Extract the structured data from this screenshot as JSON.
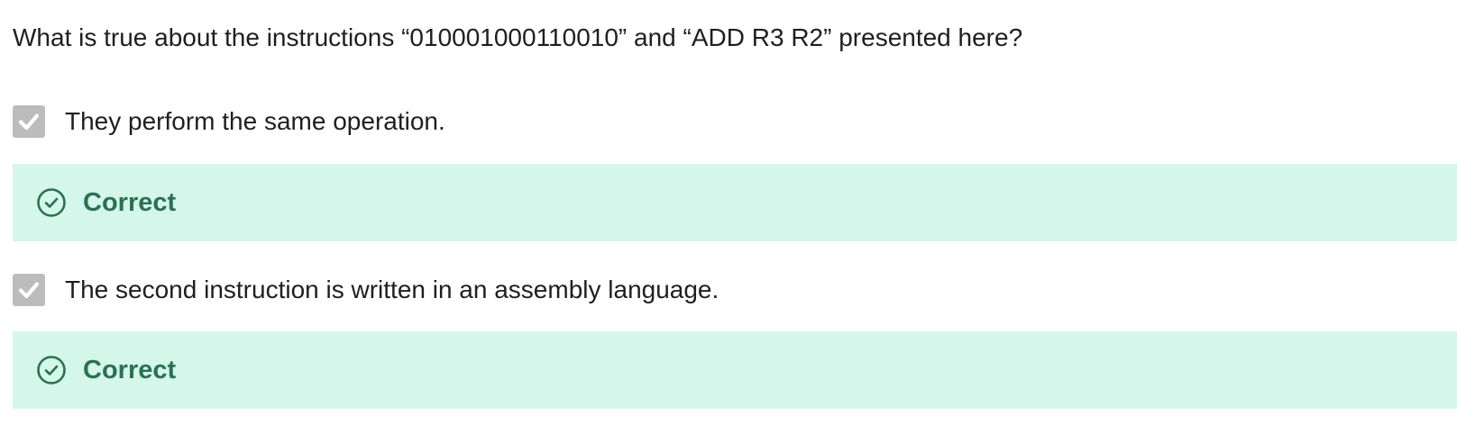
{
  "question": {
    "text": "What is true about the instructions “010001000110010” and “ADD R3 R2” presented here?"
  },
  "options": [
    {
      "label": "They perform the same operation.",
      "checked": true,
      "checkbox_icon": "checkmark-icon",
      "feedback": {
        "label": "Correct",
        "icon": "check-circle-icon"
      }
    },
    {
      "label": "The second instruction is written in an assembly language.",
      "checked": true,
      "checkbox_icon": "checkmark-icon",
      "feedback": {
        "label": "Correct",
        "icon": "check-circle-icon"
      }
    }
  ],
  "colors": {
    "text": "#1f1f1f",
    "checkbox": "#bcbcbc",
    "feedback_background": "#d5f6eb",
    "feedback_accent": "#2a7153"
  }
}
